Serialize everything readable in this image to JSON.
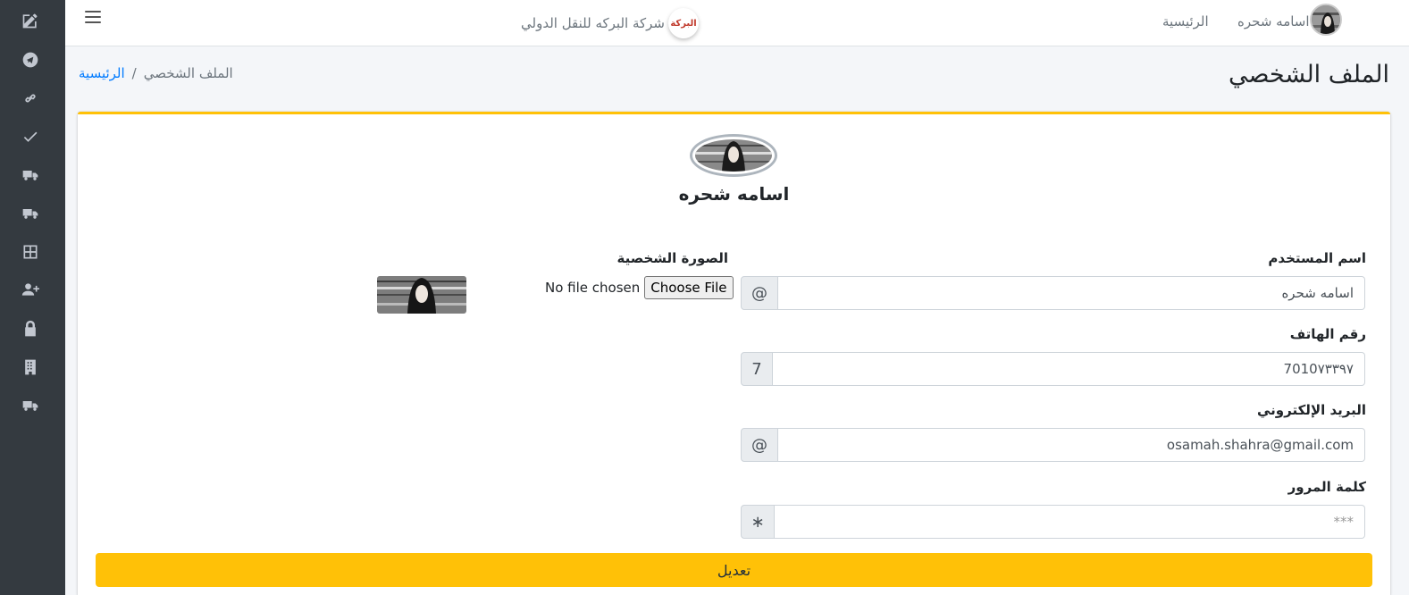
{
  "navbar": {
    "brand_text": "شركة البركه للنقل الدولي",
    "brand_logo_text": "البركة",
    "home_link": "الرئيسية",
    "user_name": "اسامه شحره"
  },
  "page": {
    "title": "الملف الشخصي",
    "breadcrumb": {
      "home": "الرئيسية",
      "separator": "/",
      "current": "الملف الشخصي"
    }
  },
  "profile": {
    "name": "اسامه شحره",
    "fields": {
      "username": {
        "label": "اسم المستخدم",
        "value": "اسامه شحره",
        "addon": "@"
      },
      "phone": {
        "label": "رقم الهاتف",
        "value": "7010٧٣٣٩٧",
        "addon": "7"
      },
      "email": {
        "label": "البريد الإلكتروني",
        "value": "osamah.shahra@gmail.com",
        "addon": "@"
      },
      "password": {
        "label": "كلمة المرور",
        "placeholder": "***",
        "addon": "∗"
      }
    },
    "photo": {
      "label": "الصورة الشخصية",
      "no_file_text": "No file chosen",
      "choose_button": "Choose File"
    },
    "submit_label": "تعديل"
  },
  "colors": {
    "sidebar_bg": "#343a40",
    "accent": "#ffc107",
    "link": "#007bff"
  },
  "sidebar_icons": [
    "edit-icon",
    "telegram-icon",
    "link-icon",
    "check-icon",
    "truck-icon",
    "truck-icon",
    "grid-icon",
    "user-plus-icon",
    "lock-icon",
    "building-icon",
    "truck-icon"
  ]
}
